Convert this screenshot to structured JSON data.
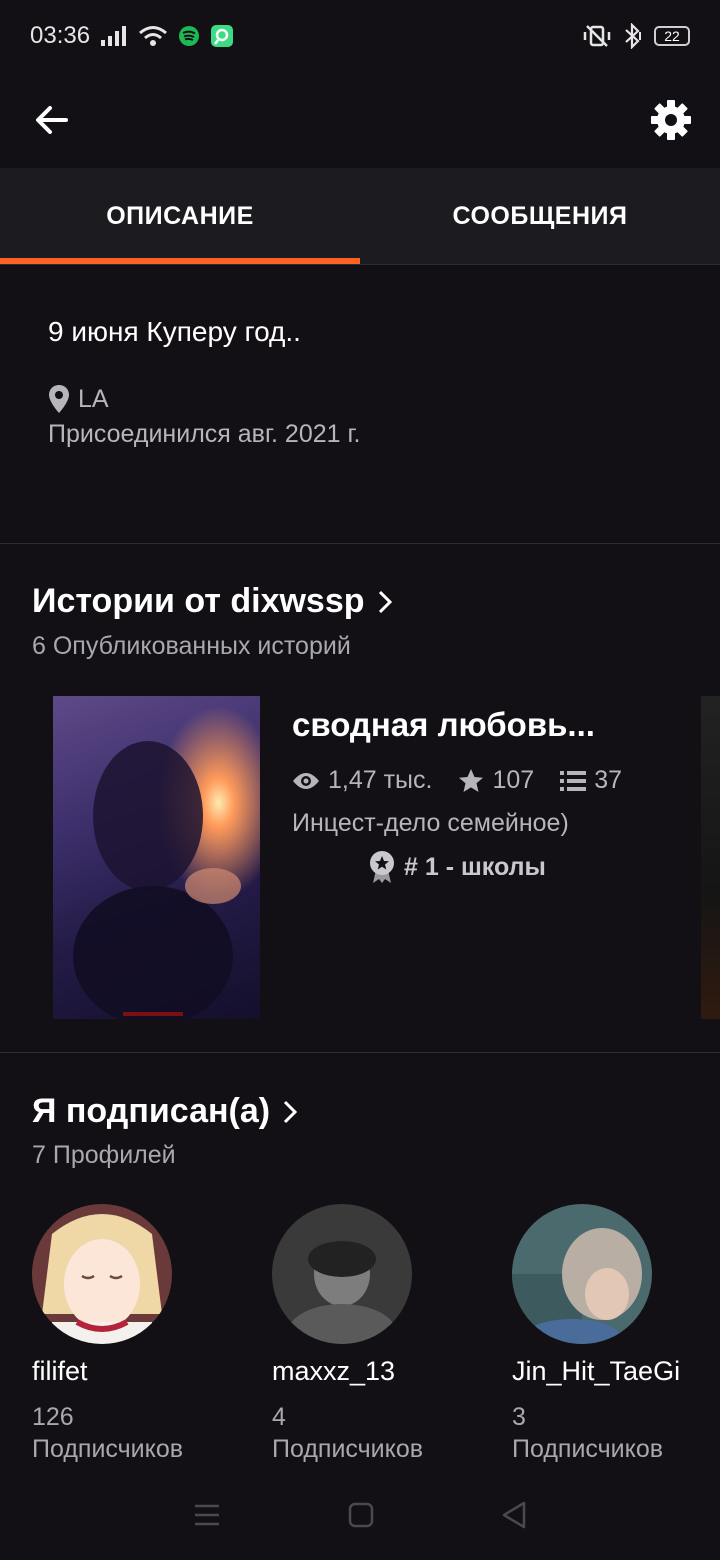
{
  "status_bar": {
    "time": "03:36",
    "battery": "22",
    "icons": [
      "signal-icon",
      "wifi-icon",
      "spotify-icon",
      "app-notification-icon",
      "vibrate-off-icon",
      "bluetooth-icon",
      "battery-icon"
    ]
  },
  "app_bar": {
    "back_icon": "arrow-left-icon",
    "settings_icon": "gear-icon"
  },
  "tabs": [
    {
      "label": "ОПИСАНИЕ",
      "active": true
    },
    {
      "label": "СООБЩЕНИЯ",
      "active": false
    }
  ],
  "description": {
    "text": "9 июня Куперу год..",
    "location": "LA",
    "joined": "Присоединился авг. 2021 г."
  },
  "stories": {
    "title": "Истории от dixwssp",
    "subtitle": "6 Опубликованных историй",
    "items": [
      {
        "title": "сводная любовь...",
        "reads": "1,47 тыс.",
        "votes": "107",
        "parts": "37",
        "tagline": "Инцест-дело семейное)",
        "rank": "# 1 - школы"
      }
    ]
  },
  "following": {
    "title": "Я подписан(а)",
    "subtitle": "7 Профилей",
    "profiles": [
      {
        "name": "filifet",
        "followers": "126",
        "followers_label": "Подписчиков"
      },
      {
        "name": "maxxz_13",
        "followers": "4",
        "followers_label": "Подписчиков"
      },
      {
        "name": "Jin_Hit_TaeGi",
        "followers": "3",
        "followers_label": "Подписчиков"
      }
    ]
  },
  "colors": {
    "accent": "#ff6122",
    "background": "#121014",
    "tab_bar": "#1c1b1f"
  }
}
